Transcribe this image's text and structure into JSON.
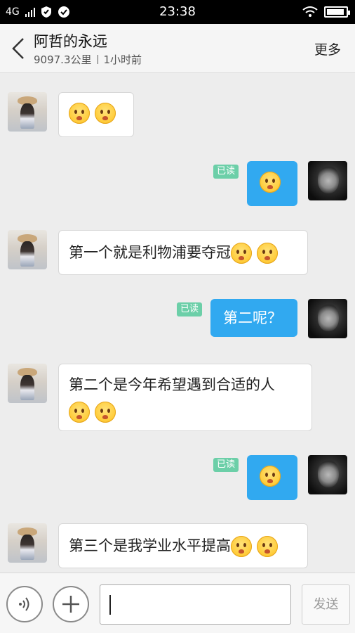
{
  "status_bar": {
    "network": "4G",
    "time": "23:38",
    "battery_level": 0.92
  },
  "header": {
    "title": "阿哲的永远",
    "distance": "9097.3公里",
    "last_active": "1小时前",
    "more_label": "更多"
  },
  "messages": [
    {
      "direction": "in",
      "text": "",
      "emoji_count": 2,
      "emoji": "worried-face-icon"
    },
    {
      "direction": "out",
      "text": "",
      "emoji_count": 1,
      "read_label": "已读"
    },
    {
      "direction": "in",
      "text": "第一个就是利物浦要夺冠",
      "emoji_count": 2
    },
    {
      "direction": "out",
      "text": "第二呢？",
      "emoji_count": 0,
      "read_label": "已读"
    },
    {
      "direction": "in",
      "text": "第二个是今年希望遇到合适的人",
      "emoji_count": 2
    },
    {
      "direction": "out",
      "text": "",
      "emoji_count": 1,
      "read_label": "已读"
    },
    {
      "direction": "in",
      "text": "第三个是我学业水平提高",
      "emoji_count": 2
    }
  ],
  "input": {
    "value": "",
    "send_label": "发送"
  },
  "colors": {
    "outgoing_bubble": "#31a9f0",
    "read_badge": "#6ccfa8",
    "background": "#ededed"
  }
}
